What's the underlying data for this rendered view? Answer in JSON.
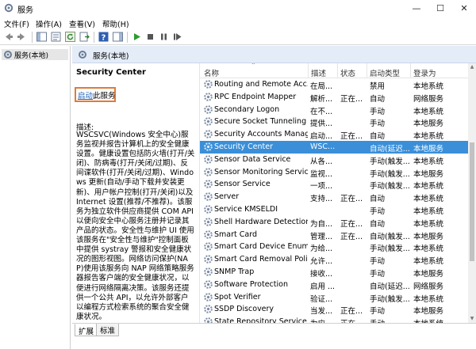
{
  "window": {
    "title": "服务",
    "controls": {
      "minimize": "—",
      "maximize": "☐",
      "close": "✕"
    }
  },
  "menu": [
    "文件(F)",
    "操作(A)",
    "查看(V)",
    "帮助(H)"
  ],
  "toolbar_icons": [
    "back-icon",
    "forward-icon",
    "show-hide-console-tree-icon",
    "properties-icon",
    "refresh-icon",
    "export-list-icon",
    "help-icon",
    "show-action-pane-icon",
    "start-icon",
    "stop-icon",
    "pause-icon",
    "restart-icon"
  ],
  "tree": {
    "root_label": "服务(本地)"
  },
  "header": {
    "label": "服务(本地)"
  },
  "description_pane": {
    "service_title": "Security Center",
    "start_link": "启动",
    "start_suffix": "此服务",
    "desc_label": "描述:",
    "desc_text": "WSCSVC(Windows 安全中心)服务监视并报告计算机上的安全健康设置。健康设置包括防火墙(打开/关闭)、防病毒(打开/关闭/过期)、反间谍软件(打开/关闭/过期)、Windows 更新(自动/手动下载并安装更新)、用户帐户控制(打开/关闭)以及 Internet 设置(推荐/不推荐)。该服务为独立软件供应商提供 COM API 以便向安全中心服务注册并记录其产品的状态。安全性与维护 UI 使用该服务在\"安全性与维护\"控制面板中提供 systray 警报和安全健康状况的图形视图。网络访问保护(NAP)使用该服务向 NAP 网络策略服务器报告客户端的安全健康状况，以便进行网络隔离决策。该服务还提供一个公共 API，以允许外部客户以编程方式检索系统的聚合安全健康状况。"
  },
  "tabs": [
    "扩展",
    "标准"
  ],
  "list": {
    "columns": [
      "名称",
      "描述",
      "状态",
      "启动类型",
      "登录为"
    ],
    "rows": [
      {
        "name": "Routing and Remote Acc...",
        "desc": "在局...",
        "status": "",
        "start": "禁用",
        "logon": "本地系统"
      },
      {
        "name": "RPC Endpoint Mapper",
        "desc": "解析...",
        "status": "正在...",
        "start": "自动",
        "logon": "网络服务"
      },
      {
        "name": "Secondary Logon",
        "desc": "在不...",
        "status": "",
        "start": "手动",
        "logon": "本地系统"
      },
      {
        "name": "Secure Socket Tunneling ...",
        "desc": "提供...",
        "status": "",
        "start": "手动",
        "logon": "本地服务"
      },
      {
        "name": "Security Accounts Manag...",
        "desc": "启动...",
        "status": "正在...",
        "start": "自动",
        "logon": "本地系统"
      },
      {
        "name": "Security Center",
        "desc": "WSC...",
        "status": "",
        "start": "自动(延迟...",
        "logon": "本地服务",
        "selected": true
      },
      {
        "name": "Sensor Data Service",
        "desc": "从各...",
        "status": "",
        "start": "手动(触发...",
        "logon": "本地系统"
      },
      {
        "name": "Sensor Monitoring Service",
        "desc": "监视...",
        "status": "",
        "start": "手动(触发...",
        "logon": "本地服务"
      },
      {
        "name": "Sensor Service",
        "desc": "一项...",
        "status": "",
        "start": "手动(触发...",
        "logon": "本地系统"
      },
      {
        "name": "Server",
        "desc": "支持...",
        "status": "正在...",
        "start": "自动",
        "logon": "本地系统"
      },
      {
        "name": "Service KMSELDI",
        "desc": "",
        "status": "",
        "start": "手动",
        "logon": "本地系统"
      },
      {
        "name": "Shell Hardware Detection",
        "desc": "为自...",
        "status": "正在...",
        "start": "自动",
        "logon": "本地系统"
      },
      {
        "name": "Smart Card",
        "desc": "管理...",
        "status": "正在...",
        "start": "自动(触发...",
        "logon": "本地服务"
      },
      {
        "name": "Smart Card Device Enum...",
        "desc": "为给...",
        "status": "",
        "start": "手动(触发...",
        "logon": "本地系统"
      },
      {
        "name": "Smart Card Removal Poli...",
        "desc": "允许...",
        "status": "",
        "start": "手动",
        "logon": "本地系统"
      },
      {
        "name": "SNMP Trap",
        "desc": "接收...",
        "status": "",
        "start": "手动",
        "logon": "本地服务"
      },
      {
        "name": "Software Protection",
        "desc": "启用 ...",
        "status": "",
        "start": "自动(延迟...",
        "logon": "网络服务"
      },
      {
        "name": "Spot Verifier",
        "desc": "验证...",
        "status": "",
        "start": "手动(触发...",
        "logon": "本地系统"
      },
      {
        "name": "SSDP Discovery",
        "desc": "当发...",
        "status": "正在...",
        "start": "手动",
        "logon": "本地服务"
      },
      {
        "name": "State Repository Service",
        "desc": "为应...",
        "status": "正在...",
        "start": "手动",
        "logon": "本地系统"
      }
    ]
  },
  "colors": {
    "selection": "#3a8fd8",
    "header_bg": "#e4ecf7",
    "link": "#1a5fb4",
    "highlight_box": "#e07b39"
  }
}
